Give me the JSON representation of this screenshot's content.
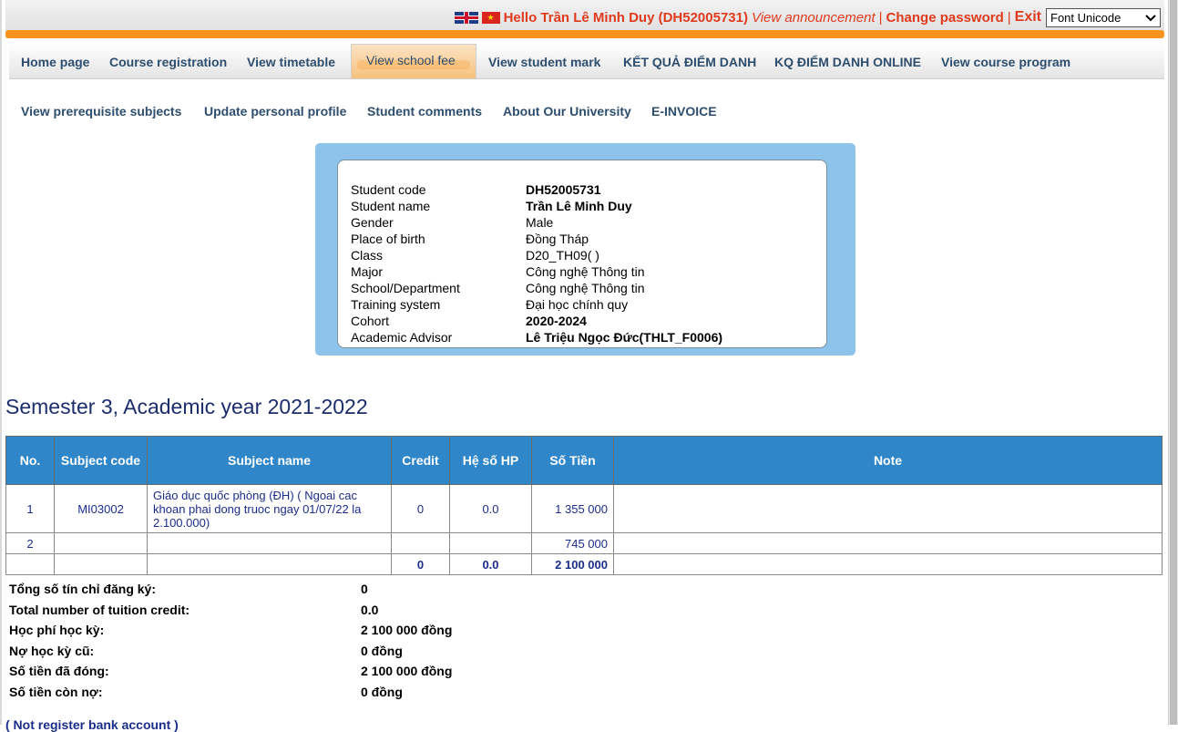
{
  "header": {
    "greeting": "Hello Trần Lê Minh Duy (DH52005731)",
    "view_announcement": "View announcement",
    "separator": "|",
    "change_password": "Change password",
    "exit": "Exit",
    "font_select_value": "Font Unicode"
  },
  "main_nav": {
    "home": "Home page",
    "course_registration": "Course registration",
    "view_timetable": "View timetable",
    "view_school_fee": "View school fee",
    "view_student_mark": "View student mark",
    "ket_qua_diem_danh": "KẾT QUẢ ĐIỂM DANH",
    "kq_diem_danh_online": "KQ ĐIỂM DANH ONLINE",
    "view_course_program": "View course program"
  },
  "sub_nav": {
    "prerequisite": "View prerequisite subjects",
    "update_profile": "Update personal profile",
    "student_comments": "Student comments",
    "about_university": "About Our University",
    "e_invoice": "E-INVOICE"
  },
  "student_info": [
    {
      "label": "Student code",
      "value": "DH52005731",
      "bold": true
    },
    {
      "label": "Student name",
      "value": "Trần Lê Minh Duy",
      "bold": true
    },
    {
      "label": "Gender",
      "value": "Male",
      "bold": false
    },
    {
      "label": "Place of birth",
      "value": "Đồng Tháp",
      "bold": false
    },
    {
      "label": "Class",
      "value": "D20_TH09( )",
      "bold": false
    },
    {
      "label": "Major",
      "value": "Công nghệ Thông tin",
      "bold": false
    },
    {
      "label": "School/Department",
      "value": "Công nghệ Thông tin",
      "bold": false
    },
    {
      "label": "Training system",
      "value": "Đại học chính quy",
      "bold": false
    },
    {
      "label": "Cohort",
      "value": "2020-2024",
      "bold": true
    },
    {
      "label": "Academic Advisor",
      "value": "Lê Triệu Ngọc Đức(THLT_F0006)",
      "bold": true
    }
  ],
  "semester_title": "Semester 3, Academic year 2021-2022",
  "fee_table": {
    "headers": [
      "No.",
      "Subject code",
      "Subject name",
      "Credit",
      "Hệ số HP",
      "Số Tiền",
      "Note"
    ],
    "rows": [
      {
        "no": "1",
        "code": "MI03002",
        "name": "Giáo dục quốc phòng (ĐH) ( Ngoai cac khoan phai dong truoc ngay 01/07/22 la 2.100.000)",
        "credit": "0",
        "hs": "0.0",
        "amount": "1 355 000",
        "note": ""
      },
      {
        "no": "2",
        "code": "",
        "name": "",
        "credit": "",
        "hs": "",
        "amount": "745 000",
        "note": ""
      }
    ],
    "totals": {
      "credit": "0",
      "hs": "0.0",
      "amount": "2 100 000"
    }
  },
  "summary": [
    {
      "label": "Tổng số tín chỉ đăng ký:",
      "value": "0"
    },
    {
      "label": "Total number of tuition credit:",
      "value": "0.0"
    },
    {
      "label": "Học phí học kỳ:",
      "value": "2 100 000 đồng"
    },
    {
      "label": "Nợ học kỳ cũ:",
      "value": "0 đồng"
    },
    {
      "label": "Số tiền đã đóng:",
      "value": "2 100 000 đồng"
    },
    {
      "label": "Số tiền còn nợ:",
      "value": "0 đồng"
    }
  ],
  "bank_link": "( Not register bank account )"
}
